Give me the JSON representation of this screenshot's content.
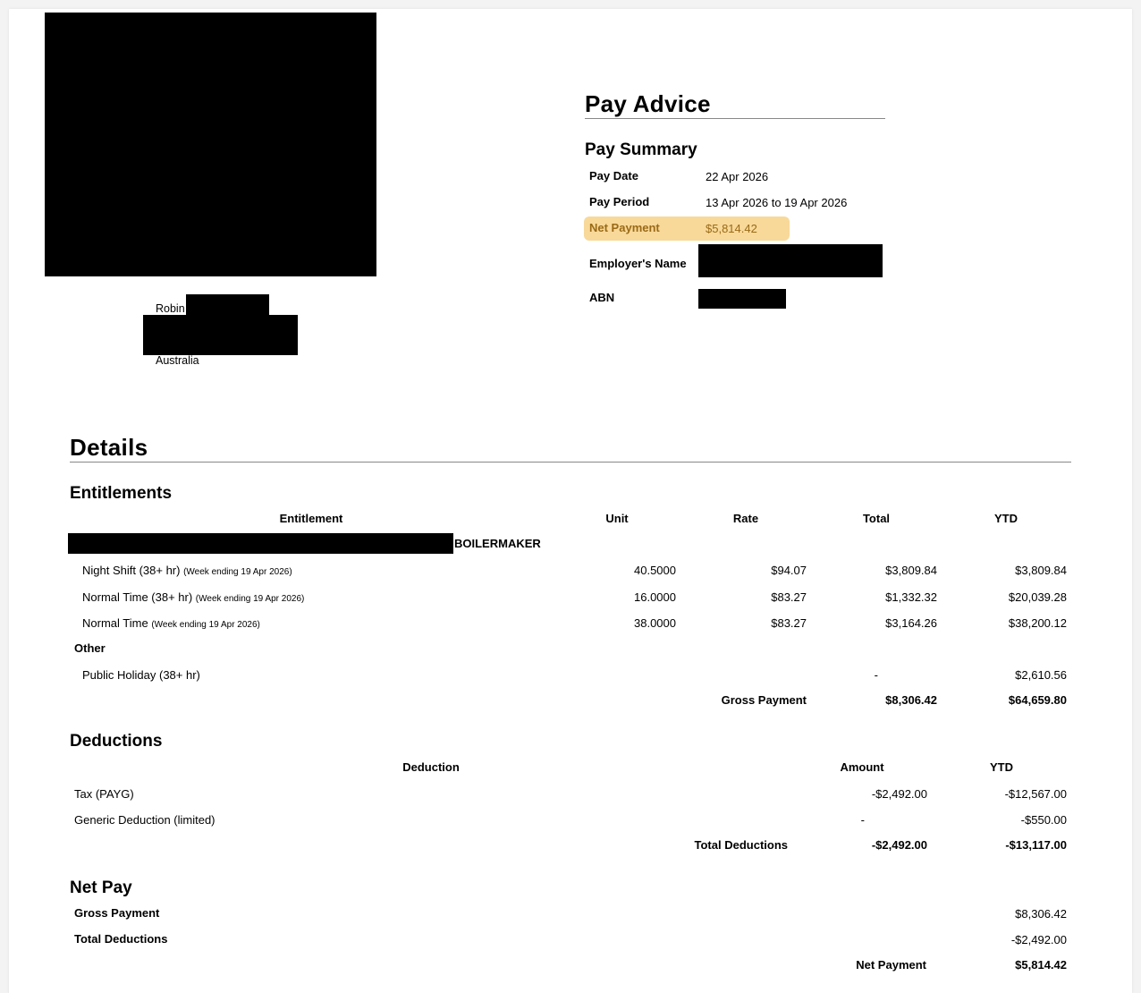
{
  "recipient": {
    "name_visible": "Robin",
    "country": "Australia"
  },
  "header": {
    "title": "Pay Advice",
    "summary_title": "Pay Summary",
    "pay_date_label": "Pay Date",
    "pay_date": "22 Apr 2026",
    "pay_period_label": "Pay Period",
    "pay_period": "13 Apr 2026 to 19 Apr 2026",
    "net_payment_label": "Net Payment",
    "net_payment": "$5,814.42",
    "employer_label": "Employer's Name",
    "abn_label": "ABN"
  },
  "details": {
    "title": "Details"
  },
  "entitlements": {
    "title": "Entitlements",
    "columns": [
      "Entitlement",
      "Unit",
      "Rate",
      "Total",
      "YTD"
    ],
    "group_label": "BOILERMAKER",
    "rows": [
      {
        "name": "Night Shift (38+ hr)",
        "note": "(Week ending 19 Apr 2026)",
        "unit": "40.5000",
        "rate": "$94.07",
        "total": "$3,809.84",
        "ytd": "$3,809.84"
      },
      {
        "name": "Normal Time (38+ hr)",
        "note": "(Week ending 19 Apr 2026)",
        "unit": "16.0000",
        "rate": "$83.27",
        "total": "$1,332.32",
        "ytd": "$20,039.28"
      },
      {
        "name": "Normal Time",
        "note": "(Week ending 19 Apr 2026)",
        "unit": "38.0000",
        "rate": "$83.27",
        "total": "$3,164.26",
        "ytd": "$38,200.12"
      }
    ],
    "other_label": "Other",
    "other_rows": [
      {
        "name": "Public Holiday (38+ hr)",
        "total": "-",
        "ytd": "$2,610.56"
      }
    ],
    "gross_label": "Gross Payment",
    "gross_total": "$8,306.42",
    "gross_ytd": "$64,659.80"
  },
  "deductions": {
    "title": "Deductions",
    "columns": [
      "Deduction",
      "Amount",
      "YTD"
    ],
    "rows": [
      {
        "name": "Tax (PAYG)",
        "amount": "-$2,492.00",
        "ytd": "-$12,567.00"
      },
      {
        "name": "Generic Deduction (limited)",
        "amount": "-",
        "ytd": "-$550.00"
      }
    ],
    "total_label": "Total Deductions",
    "total_amount": "-$2,492.00",
    "total_ytd": "-$13,117.00"
  },
  "net_pay": {
    "title": "Net Pay",
    "gross_label": "Gross Payment",
    "gross_value": "$8,306.42",
    "deductions_label": "Total Deductions",
    "deductions_value": "-$2,492.00",
    "net_label": "Net Payment",
    "net_value": "$5,814.42"
  },
  "colors": {
    "highlight": "#f8d99a",
    "highlight_text": "#9a6a16",
    "redaction": "#000000"
  }
}
